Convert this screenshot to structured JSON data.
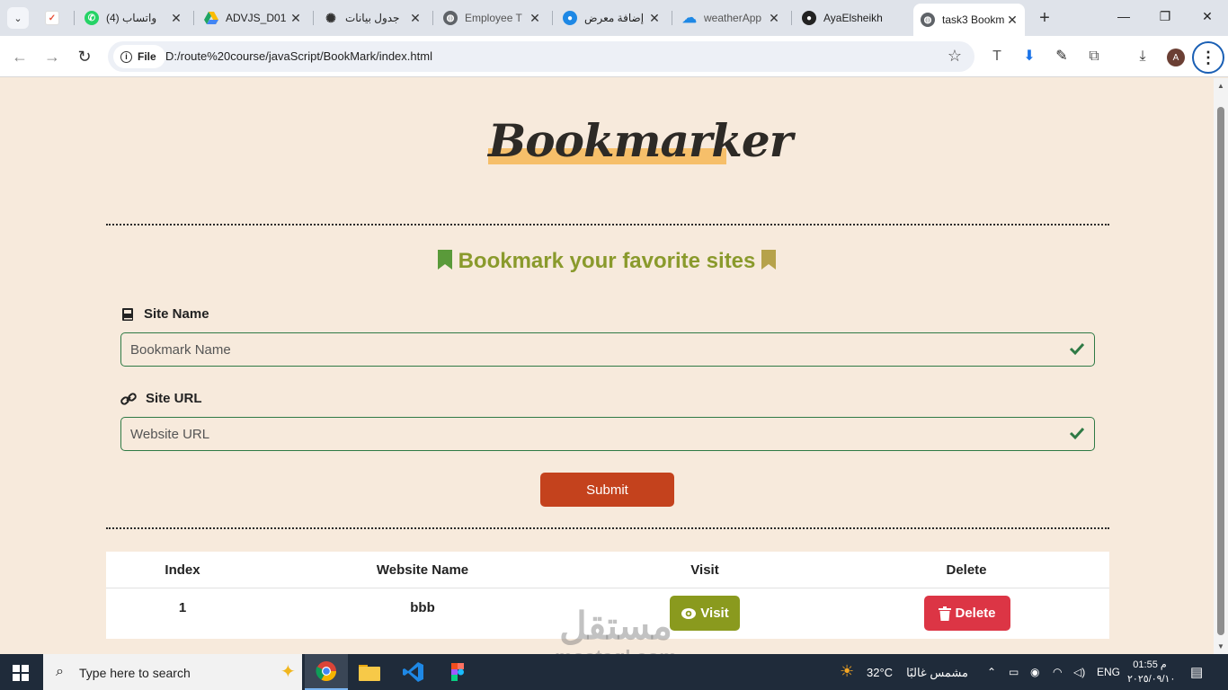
{
  "browser": {
    "tabs": [
      {
        "title": "",
        "favicon": "todo-check-icon",
        "color": "#e8523a"
      },
      {
        "title": "(4) واتساب",
        "favicon": "whatsapp-icon",
        "color": "#25d366"
      },
      {
        "title": "ADVJS_D01",
        "favicon": "drive-icon",
        "color": "#1fa463"
      },
      {
        "title": "جدول بيانات",
        "favicon": "chatgpt-icon",
        "color": "#333333"
      },
      {
        "title": "Employee T",
        "favicon": "globe-icon",
        "color": "#5f6368"
      },
      {
        "title": "إضافة معرض",
        "favicon": "circle-icon",
        "color": "#1e88e5"
      },
      {
        "title": "weatherApp",
        "favicon": "cloud-icon",
        "color": "#1e88e5"
      },
      {
        "title": "AyaElsheikh",
        "favicon": "github-icon",
        "color": "#222222"
      },
      {
        "title": "task3 Bookm",
        "favicon": "globe-icon",
        "color": "#5f6368"
      }
    ],
    "file_chip": "File",
    "url": "D:/route%20course/javaScript/BookMark/index.html",
    "avatar_initial": "A"
  },
  "page": {
    "logo": "Bookmarker",
    "heading": "Bookmark your favorite sites",
    "site_name_label": "Site Name",
    "site_name_placeholder": "Bookmark Name",
    "site_url_label": "Site URL",
    "site_url_placeholder": "Website URL",
    "submit_label": "Submit",
    "table": {
      "headers": [
        "Index",
        "Website Name",
        "Visit",
        "Delete"
      ],
      "rows": [
        {
          "index": "1",
          "name": "bbb",
          "visit_label": "Visit",
          "delete_label": "Delete"
        }
      ]
    },
    "colors": {
      "background": "#f7eadc",
      "accent_olive": "#8a9a1e",
      "submit": "#c4421d",
      "delete": "#dc3545",
      "valid_border": "#2f7a45"
    }
  },
  "watermark": {
    "arabic": "مستقل",
    "latin": "mostaql.com"
  },
  "taskbar": {
    "search_text": "Type here to search",
    "weather_temp": "32°C",
    "weather_desc": "مشمس غالبًا",
    "language": "ENG",
    "time": "01:55 م",
    "date": "٢٠٢٥/٠٩/١٠"
  }
}
